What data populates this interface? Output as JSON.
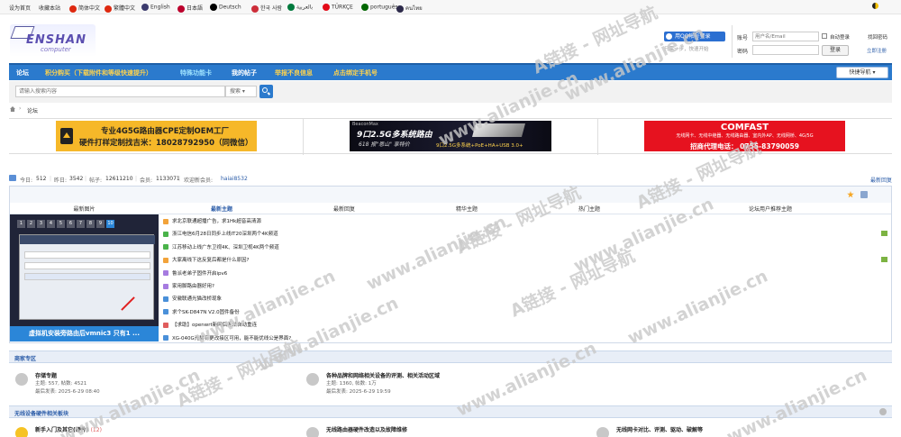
{
  "topbar": {
    "set_home": "设为首页",
    "bookmark": "收藏本站",
    "languages": [
      {
        "label": "简体中文",
        "color": "#de2910"
      },
      {
        "label": "繁體中文",
        "color": "#de2910"
      },
      {
        "label": "English",
        "color": "#3c3b6e"
      },
      {
        "label": "日本語",
        "color": "#bc002d"
      },
      {
        "label": "Deutsch",
        "color": "#000000"
      },
      {
        "label": "한국 사람",
        "color": "#cd2e3a"
      },
      {
        "label": "بالعربية",
        "color": "#007a3d"
      },
      {
        "label": "TÜRKÇE",
        "color": "#e30a17"
      },
      {
        "label": "português",
        "color": "#006600"
      },
      {
        "label": "คนไทย",
        "color": "#2d2a4a"
      }
    ]
  },
  "header": {
    "logo_text": "ENSHAN",
    "logo_sub": "computer",
    "qq_button": "用QQ帐号登录",
    "qq_sub": "只需一步，快速开始",
    "account_label": "账号",
    "account_placeholder": "用户名/Email",
    "password_label": "密码",
    "auto_login": "自动登录",
    "forgot_password": "找回密码",
    "login_button": "登录",
    "register": "立即注册"
  },
  "nav": {
    "items": [
      "论坛",
      "积分购买（下载附件和等级快速提升）",
      "特殊功能卡",
      "我的帖子",
      "举报不良信息",
      "点击绑定手机号"
    ],
    "quick_nav": "快捷导航"
  },
  "search": {
    "placeholder": "请输入搜索内容",
    "type": "搜索"
  },
  "breadcrumb": {
    "current": "论坛"
  },
  "ads": {
    "ad1_line1": "专业4G5G路由器CPE定制OEM工厂",
    "ad1_line2": "硬件打样定制找吉米：18028792950（同微信）",
    "ad2_brand": "BeaconMax",
    "ad2_line1": "9口2.5G多系统路由",
    "ad2_line2": "618 报\"恩山\" 享特价",
    "ad2_line3": "9口2.5G多系统+PoE+HA+USB 3.0+",
    "ad3_brand": "COMFAST",
    "ad3_line1": "无线网卡、无线中继器、无线路由器、室内外AP、无线网桥、4G/5G",
    "ad3_line2": "招商代理电话：  0755-83790059"
  },
  "stats": {
    "today_label": "今日:",
    "today": "512",
    "yesterday_label": "昨日:",
    "yesterday": "3542",
    "posts_label": "帖子:",
    "posts": "12611210",
    "members_label": "会员:",
    "members": "1133071",
    "welcome_label": "欢迎新会员:",
    "new_member": "haiai8532",
    "latest_reply": "最新回复"
  },
  "tabs": [
    "最新图片",
    "最新主题",
    "最新回复",
    "精华主题",
    "热门主题",
    "论坛用户推荐主题"
  ],
  "slideshow": {
    "numbers": [
      "1",
      "2",
      "3",
      "4",
      "5",
      "6",
      "7",
      "8",
      "9",
      "10"
    ],
    "caption": "虚拟机安装旁路由后vmnic3 只有1 ..."
  },
  "threads": [
    "求北京联通超播广告，求1Hk超音高清源",
    "浙江电信6月28日同步上线IT20深圳两个4K频道",
    "江苏移动上线广东卫视4K、深圳卫视4K两个频道",
    "大家离线下这反复后都是什么原因?",
    "鲁派老弟子固件开启ipv6",
    "家用脚路由器好用?",
    "安徽联通光猫改桥现象",
    "求个SK-D847N V2.0固件备份",
    "【求助】openwrt新网后无法自动重连",
    "XG-040G光猫有更改接区可用，能不能优线公是界面?"
  ],
  "thread_icon_colors": [
    "#f2a33a",
    "#4ab34a",
    "#4ab34a",
    "#f2a33a",
    "#a67be0",
    "#a67be0",
    "#4a90d9",
    "#4a90d9",
    "#e05d5d",
    "#4a90d9"
  ],
  "sections": {
    "business": {
      "title": "商家专区",
      "forum1": {
        "name": "存储专题",
        "stats": "主题: 557, 帖数: 4521",
        "last": "最后发表: 2025-6-29 08:40"
      },
      "forum2": {
        "name": "各种品牌和网络相关设备的评测、相关活动区域",
        "stats": "主题: 1360, 帖数: 1万",
        "last": "最后发表: 2025-6-29 19:59"
      }
    },
    "wireless": {
      "title": "无线设备硬件相关板块",
      "forum1": {
        "name": "新手入门及其它(硬件)",
        "count": "(12)"
      },
      "forum2": {
        "name": "无线路由器硬件改造以及故障维修"
      },
      "forum3": {
        "name": "无线网卡对比、评测、驱动、破解等"
      }
    }
  },
  "watermark": {
    "text1": "A链接 - 网址导航",
    "text2": "www.alianjie.cn"
  },
  "colors": {
    "nav": "#2b7acd",
    "section": "#e8eef7",
    "link": "#2b5ca8"
  }
}
